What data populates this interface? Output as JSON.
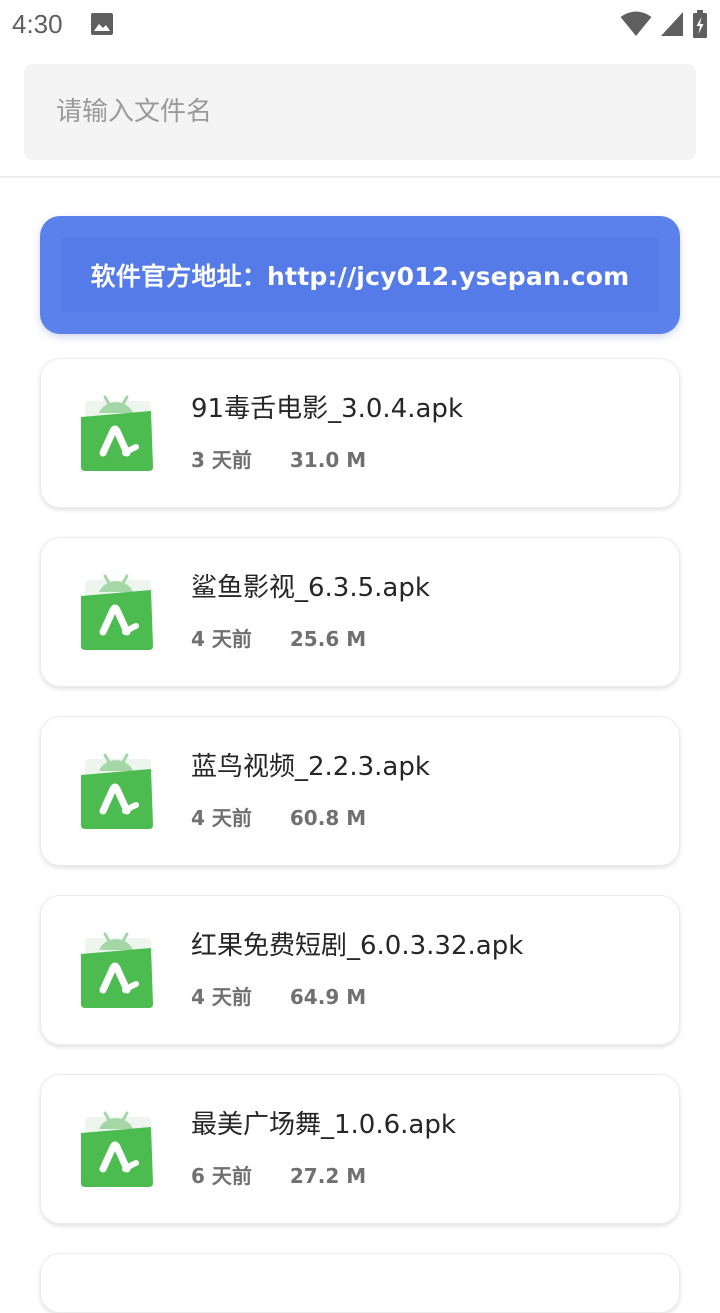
{
  "status_bar": {
    "time": "4:30",
    "icons": [
      "image-icon",
      "wifi-icon",
      "signal-icon",
      "battery-charging-icon"
    ]
  },
  "search": {
    "placeholder": "请输入文件名",
    "value": ""
  },
  "banner": {
    "text": "软件官方地址：http://jcy012.ysepan.com",
    "color": "#5b82ec"
  },
  "files": [
    {
      "name": "91毒舌电影_3.0.4.apk",
      "age": "3 天前",
      "size": "31.0 M",
      "icon": "apk-android-icon"
    },
    {
      "name": "鲨鱼影视_6.3.5.apk",
      "age": "4 天前",
      "size": "25.6 M",
      "icon": "apk-android-icon"
    },
    {
      "name": "蓝鸟视频_2.2.3.apk",
      "age": "4 天前",
      "size": "60.8 M",
      "icon": "apk-android-icon"
    },
    {
      "name": "红果免费短剧_6.0.3.32.apk",
      "age": "4 天前",
      "size": "64.9 M",
      "icon": "apk-android-icon"
    },
    {
      "name": "最美广场舞_1.0.6.apk",
      "age": "6 天前",
      "size": "27.2 M",
      "icon": "apk-android-icon"
    }
  ],
  "colors": {
    "apk_green": "#4cbc50",
    "apk_green_light": "#a5d6a7",
    "meta_text": "#707070"
  }
}
